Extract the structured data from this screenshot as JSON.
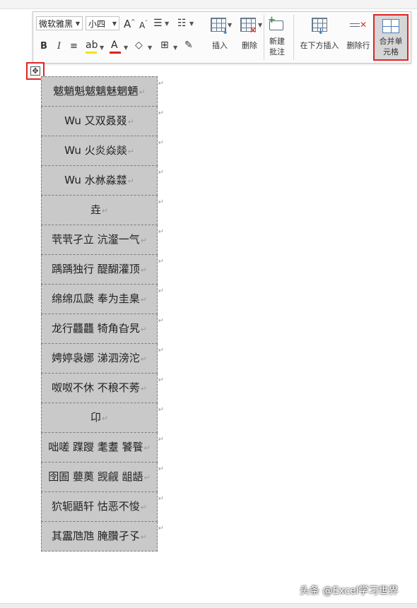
{
  "toolbar": {
    "font_name": "微软雅黑",
    "font_size": "小四",
    "grow_font": "A",
    "shrink_font": "A",
    "bold": "B",
    "italic": "I",
    "font_color_letter": "A",
    "insert_label": "插入",
    "delete_label": "删除",
    "new_comment_label": "新建\n批注",
    "insert_below_label": "在下方插入",
    "delete_row_label": "删除行",
    "merge_cells_label": "合并单\n元格",
    "highlight_color": "#f5e400",
    "font_color": "#e02020",
    "accent_red": "#e02424"
  },
  "table": {
    "rows": [
      {
        "text": "魃魈魁魃魑魅魍魉"
      },
      {
        "text": "Wu  又双叒叕"
      },
      {
        "text": "Wu  火炎焱燚"
      },
      {
        "text": "Wu  水沝淼㵘"
      },
      {
        "text": "垚"
      },
      {
        "text": "茕茕孑立  沆瀣一气"
      },
      {
        "text": "踽踽独行  醍醐灌顶"
      },
      {
        "text": "绵绵瓜瓞  奉为圭臬"
      },
      {
        "text": "龙行龘龘  犄角旮旯"
      },
      {
        "text": "娉婷袅娜  涕泗滂沱"
      },
      {
        "text": "呶呶不休  不稂不莠"
      },
      {
        "text": "卬"
      },
      {
        "text": "咄嗟  蹀躞  耄耋  饕餮",
        "tall": true
      },
      {
        "text": "囹圄  蘡薁  觊觎  龃龉",
        "tall": true
      },
      {
        "text": "狖轭鼯轩  怙恶不悛"
      },
      {
        "text": "其靁虺虺  腌臢孑孓"
      }
    ]
  },
  "watermark": "头条 @Excel学习世界"
}
